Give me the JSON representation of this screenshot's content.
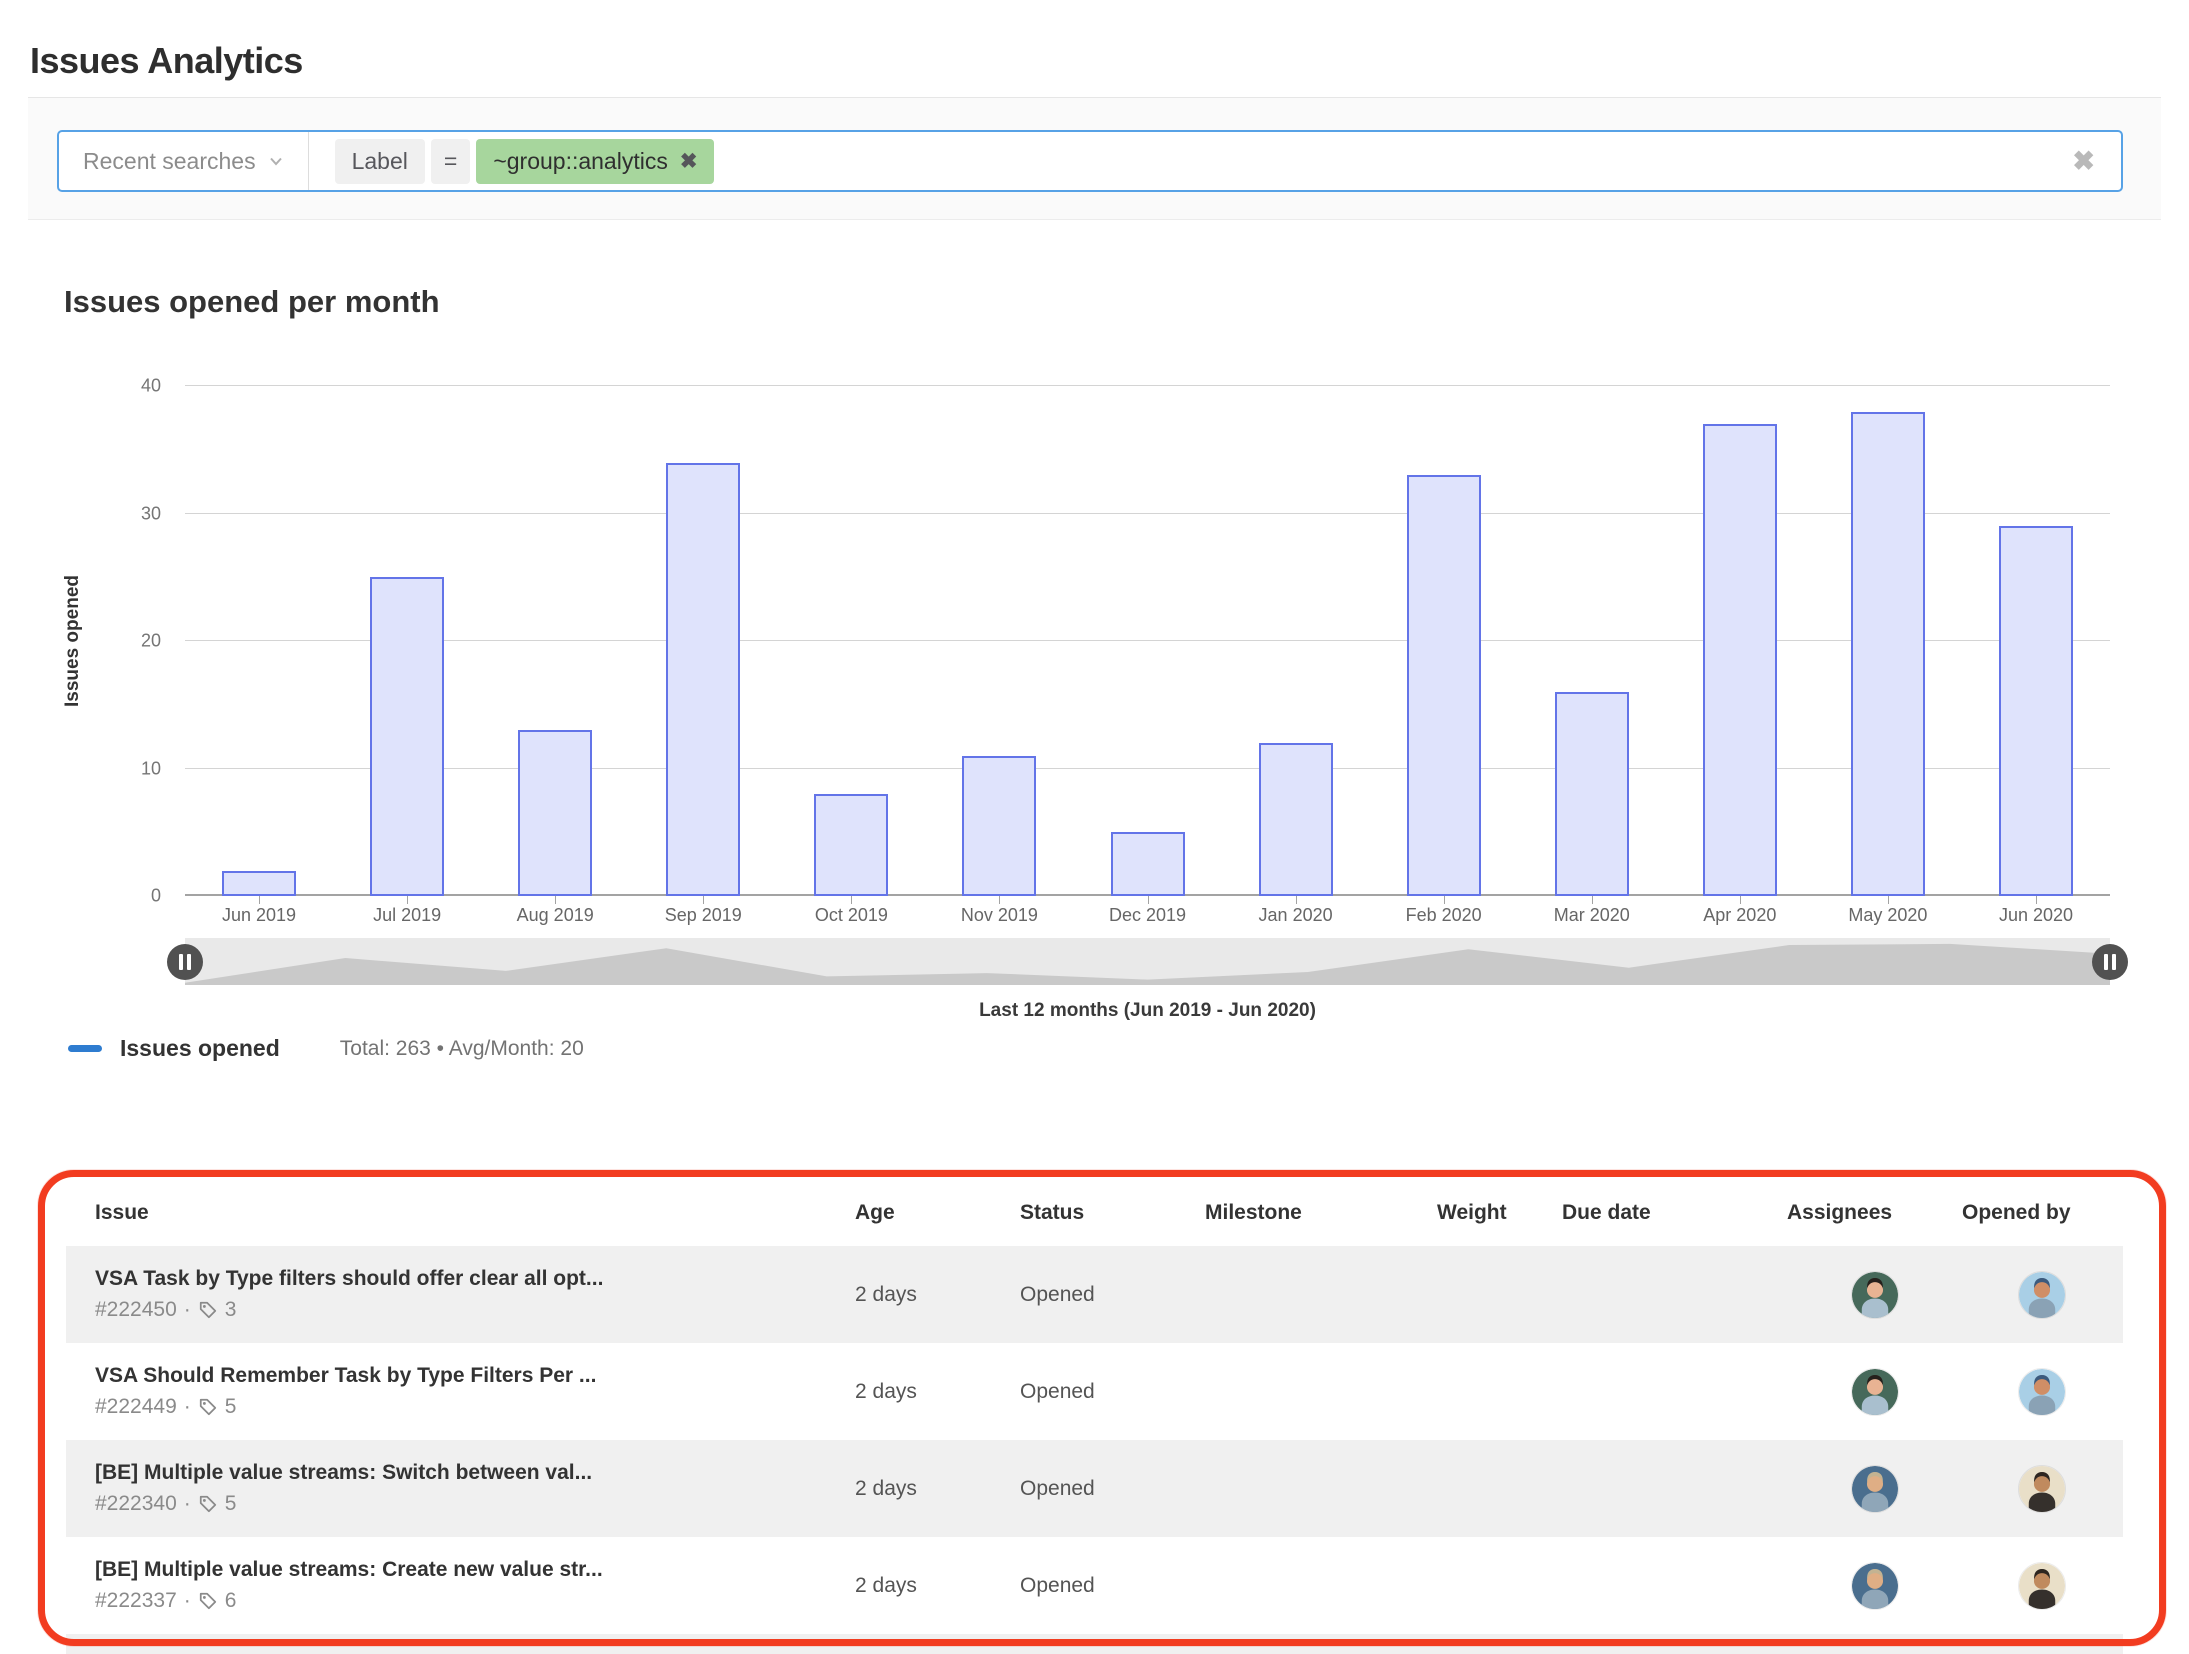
{
  "page": {
    "title": "Issues Analytics"
  },
  "icons": {
    "close": "✖",
    "chip_close": "✖"
  },
  "filter": {
    "recent_label": "Recent searches",
    "token_field": "Label",
    "token_operator": "=",
    "token_value": "~group::analytics"
  },
  "chart_data": {
    "type": "bar",
    "title": "Issues opened per month",
    "categories": [
      "Jun 2019",
      "Jul 2019",
      "Aug 2019",
      "Sep 2019",
      "Oct 2019",
      "Nov 2019",
      "Dec 2019",
      "Jan 2020",
      "Feb 2020",
      "Mar 2020",
      "Apr 2020",
      "May 2020",
      "Jun 2020"
    ],
    "values": [
      2,
      25,
      13,
      34,
      8,
      11,
      5,
      12,
      33,
      16,
      37,
      38,
      29
    ],
    "series_name": "Issues opened",
    "xlabel": "",
    "ylabel": "Issues opened",
    "yticks": [
      0,
      10,
      20,
      30,
      40
    ],
    "ylim": [
      0,
      40
    ],
    "grid": true,
    "legend_position": "bottom-left",
    "subtitle": "Last 12 months (Jun 2019 - Jun 2020)",
    "bar_fill": "#dfe3fc",
    "bar_stroke": "#6374e8"
  },
  "legend": {
    "series_label": "Issues opened",
    "summary": "Total: 263 • Avg/Month: 20",
    "marker_color": "#2e7cd0"
  },
  "table": {
    "columns": [
      "Issue",
      "Age",
      "Status",
      "Milestone",
      "Weight",
      "Due date",
      "Assignees",
      "Opened by"
    ],
    "rows": [
      {
        "title": "VSA Task by Type filters should offer clear all opt...",
        "id": "#222450",
        "label_count": "3",
        "age": "2 days",
        "status": "Opened",
        "milestone": "",
        "weight": "",
        "due_date": "",
        "assignee": "assignee-a",
        "opened_by": "opener-a"
      },
      {
        "title": "VSA Should Remember Task by Type Filters Per ...",
        "id": "#222449",
        "label_count": "5",
        "age": "2 days",
        "status": "Opened",
        "milestone": "",
        "weight": "",
        "due_date": "",
        "assignee": "assignee-a",
        "opened_by": "opener-a"
      },
      {
        "title": "[BE] Multiple value streams: Switch between val...",
        "id": "#222340",
        "label_count": "5",
        "age": "2 days",
        "status": "Opened",
        "milestone": "",
        "weight": "",
        "due_date": "",
        "assignee": "assignee-b",
        "opened_by": "opener-b"
      },
      {
        "title": "[BE] Multiple value streams: Create new value str...",
        "id": "#222337",
        "label_count": "6",
        "age": "2 days",
        "status": "Opened",
        "milestone": "",
        "weight": "",
        "due_date": "",
        "assignee": "assignee-b",
        "opened_by": "opener-b"
      }
    ]
  },
  "avatars": {
    "assignee-a": {
      "bg": "#46695a",
      "skin": "#e8b393",
      "shirt": "#a9bfce",
      "hair": "#26201c"
    },
    "opener-a": {
      "bg": "#a9cfe6",
      "skin": "#d08e66",
      "shirt": "#8aa2b5",
      "hair": "#3c5a7d"
    },
    "assignee-b": {
      "bg": "#4a6e8e",
      "skin": "#dfae85",
      "shirt": "#8fa6b8",
      "hair": "#c3b392"
    },
    "opener-b": {
      "bg": "#e9dfc8",
      "skin": "#c08a5e",
      "shirt": "#35302c",
      "hair": "#2e2620"
    }
  },
  "annotation": {
    "color": "#f23c20"
  }
}
